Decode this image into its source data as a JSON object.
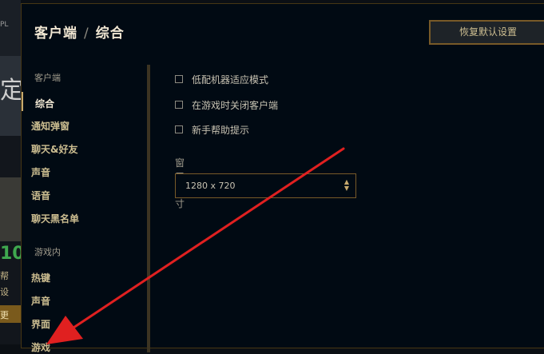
{
  "background": {
    "text_top": "PL",
    "text_big": "定",
    "text_num": "10",
    "text_a": "帮",
    "text_b": "设",
    "text_c": "更"
  },
  "header": {
    "crumb_parent": "客户端",
    "separator": "/",
    "crumb_current": "综合",
    "reset_label": "恢复默认设置"
  },
  "sidebar": {
    "section_client": "客户端",
    "client_items": [
      "综合",
      "通知弹窗",
      "聊天&好友",
      "声音",
      "语音",
      "聊天黑名单"
    ],
    "section_ingame": "游戏内",
    "ingame_items": [
      "热键",
      "声音",
      "界面",
      "游戏"
    ]
  },
  "content": {
    "checkboxes": [
      {
        "label": "低配机器适应模式",
        "checked": false
      },
      {
        "label": "在游戏时关闭客户端",
        "checked": false
      },
      {
        "label": "新手帮助提示",
        "checked": false
      }
    ],
    "window_size_label": "窗口尺寸",
    "window_size_value": "1280 x 720"
  },
  "colors": {
    "gold": "#c8aa6e",
    "border": "#785a28",
    "arrow": "#e02020"
  }
}
